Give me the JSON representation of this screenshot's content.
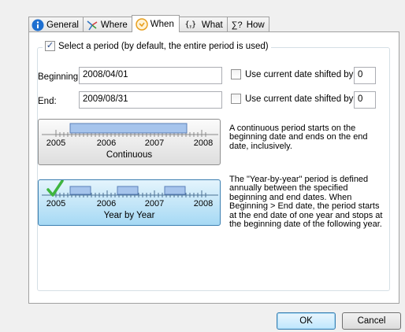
{
  "tabs": [
    {
      "label": "General",
      "icon": "info-icon"
    },
    {
      "label": "Where",
      "icon": "compass-icon"
    },
    {
      "label": "When",
      "icon": "clock-icon"
    },
    {
      "label": "What",
      "icon": "variable-icon"
    },
    {
      "label": "How",
      "icon": "sigma-icon"
    }
  ],
  "tab_icon_glyphs": {
    "what": "{ᵧ}",
    "how": "∑?"
  },
  "period": {
    "checkbox_label": "Select a period (by default, the entire period is used)",
    "checked": true,
    "beginning_label": "Beginning:",
    "beginning_value": "2008/04/01",
    "end_label": "End:",
    "end_value": "2009/08/31",
    "shift_label": "Use current date shifted by:",
    "beginning_shift_value": "0",
    "end_shift_value": "0"
  },
  "continuous": {
    "years": [
      "2005",
      "2006",
      "2007",
      "2008"
    ],
    "caption": "Continuous",
    "description": [
      "A continuous period starts on the",
      "beginning date and ends on the end",
      "date, inclusively."
    ]
  },
  "year_by_year": {
    "years": [
      "2005",
      "2006",
      "2007",
      "2008"
    ],
    "caption": "Year by Year",
    "selected": true,
    "description": [
      "The \"Year-by-year\" period is defined",
      "annually between the specified",
      "beginning and end dates. When",
      "Beginning > End date, the period starts",
      "at the end date of one year and stops at",
      "the beginning date of the following year."
    ]
  },
  "buttons": {
    "ok": "OK",
    "cancel": "Cancel"
  },
  "colors": {
    "bar_fill": "#a6c4ec",
    "bar_stroke": "#5a7fb8",
    "check_green": "#3eb53e",
    "info_blue": "#1e6fd0",
    "clock_orange": "#e8a020"
  }
}
